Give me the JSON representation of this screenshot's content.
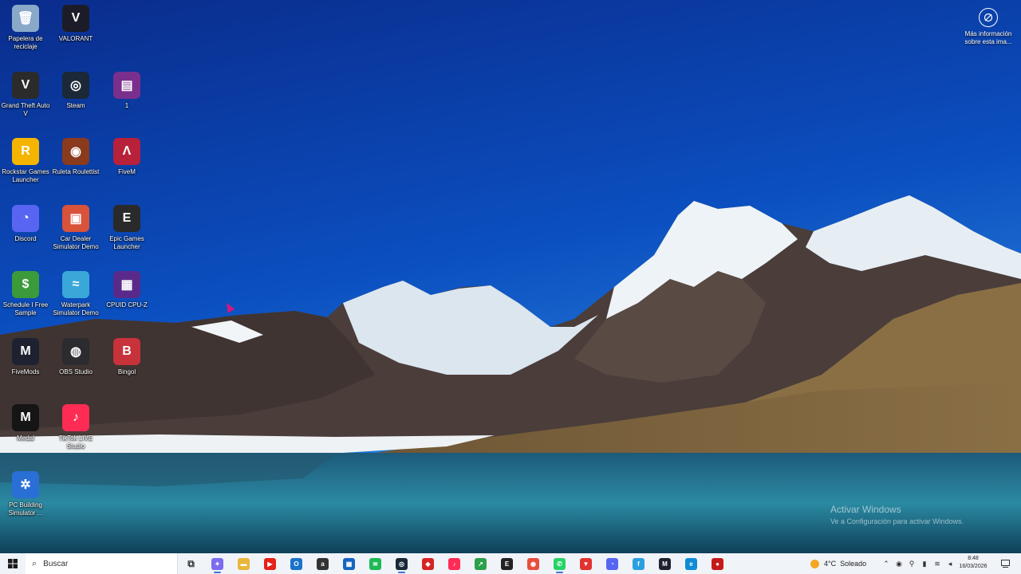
{
  "desktop": {
    "icons": [
      {
        "label": "Papelera de reciclaje",
        "icon": "recycle-bin-icon",
        "color": "#8aa9c9",
        "glyph": "🗑"
      },
      {
        "label": "VALORANT",
        "icon": "valorant-icon",
        "color": "#1c1c28",
        "glyph": "V"
      },
      {
        "label": "Grand Theft Auto V",
        "icon": "gta-v-icon",
        "color": "#2b2b2b",
        "glyph": "V"
      },
      {
        "label": "Steam",
        "icon": "steam-icon",
        "color": "#1b2838",
        "glyph": "◎"
      },
      {
        "label": "1",
        "icon": "winrar-icon",
        "color": "#7a2f8c",
        "glyph": "▤"
      },
      {
        "label": "Rockstar Games Launcher",
        "icon": "rockstar-icon",
        "color": "#f4b400",
        "glyph": "R"
      },
      {
        "label": "Ruleta Roulettist",
        "icon": "roulette-icon",
        "color": "#8a3a1d",
        "glyph": "◉"
      },
      {
        "label": "FiveM",
        "icon": "fivem-icon",
        "color": "#b8213a",
        "glyph": "Λ"
      },
      {
        "label": "Discord",
        "icon": "discord-icon",
        "color": "#5865f2",
        "glyph": "◔"
      },
      {
        "label": "Car Dealer Simulator Demo",
        "icon": "car-dealer-icon",
        "color": "#d9523a",
        "glyph": "▣"
      },
      {
        "label": "Epic Games Launcher",
        "icon": "epic-games-icon",
        "color": "#2a2a2a",
        "glyph": "E"
      },
      {
        "label": "Schedule I Free Sample",
        "icon": "schedule-i-icon",
        "color": "#3b9a3a",
        "glyph": "$"
      },
      {
        "label": "Waterpark Simulator Demo",
        "icon": "waterpark-icon",
        "color": "#3aa7d9",
        "glyph": "≈"
      },
      {
        "label": "CPUID CPU-Z",
        "icon": "cpu-z-icon",
        "color": "#5a2a8a",
        "glyph": "▦"
      },
      {
        "label": "FiveMods",
        "icon": "fivemods-icon",
        "color": "#1e2230",
        "glyph": "M"
      },
      {
        "label": "OBS Studio",
        "icon": "obs-icon",
        "color": "#2b2b30",
        "glyph": "◍"
      },
      {
        "label": "Bingol",
        "icon": "bingol-icon",
        "color": "#c8323a",
        "glyph": "B"
      },
      {
        "label": "Medal",
        "icon": "medal-icon",
        "color": "#151515",
        "glyph": "M"
      },
      {
        "label": "TikTok LIVE Studio",
        "icon": "tiktok-live-icon",
        "color": "#fe2c55",
        "glyph": "♪"
      },
      {
        "label": "PC Building Simulator ...",
        "icon": "pc-building-icon",
        "color": "#2a6fd6",
        "glyph": "✲"
      }
    ],
    "more_info": "Más información sobre esta ima...",
    "watermark": {
      "title": "Activar Windows",
      "subtitle": "Ve a Configuración para activar Windows."
    }
  },
  "taskbar": {
    "search_placeholder": "Buscar",
    "apps": [
      {
        "name": "task-view-icon",
        "color": "#445",
        "glyph": "⧉"
      },
      {
        "name": "copilot-icon",
        "color": "#7b6cf0",
        "glyph": "✦"
      },
      {
        "name": "file-explorer-icon",
        "color": "#e8b63a",
        "glyph": "▬"
      },
      {
        "name": "youtube-icon",
        "color": "#e62117",
        "glyph": "▶"
      },
      {
        "name": "outlook-icon",
        "color": "#1a73c9",
        "glyph": "O"
      },
      {
        "name": "amazon-icon",
        "color": "#333",
        "glyph": "a"
      },
      {
        "name": "microsoft-store-icon",
        "color": "#1565c0",
        "glyph": "▦"
      },
      {
        "name": "spotify-icon",
        "color": "#1db954",
        "glyph": "≋"
      },
      {
        "name": "steam-taskbar-icon",
        "color": "#1b2838",
        "glyph": "◎"
      },
      {
        "name": "red-app-icon",
        "color": "#d62424",
        "glyph": "◆"
      },
      {
        "name": "tiktok-taskbar-icon",
        "color": "#fe2c55",
        "glyph": "♪"
      },
      {
        "name": "green-app-icon",
        "color": "#2ca04a",
        "glyph": "↗"
      },
      {
        "name": "epic-taskbar-icon",
        "color": "#222",
        "glyph": "E"
      },
      {
        "name": "chrome-icon",
        "color": "#e84c3d",
        "glyph": "◉"
      },
      {
        "name": "whatsapp-icon",
        "color": "#25d366",
        "glyph": "✆"
      },
      {
        "name": "brave-icon",
        "color": "#e0332f",
        "glyph": "▼"
      },
      {
        "name": "discord-taskbar-icon",
        "color": "#5865f2",
        "glyph": "◔"
      },
      {
        "name": "notes-app-icon",
        "color": "#2aa0e0",
        "glyph": "f"
      },
      {
        "name": "fivemods-taskbar-icon",
        "color": "#1e2230",
        "glyph": "M"
      },
      {
        "name": "edge-icon",
        "color": "#0f8bd6",
        "glyph": "e"
      },
      {
        "name": "record-app-icon",
        "color": "#c41a1a",
        "glyph": "●"
      }
    ],
    "weather": {
      "temp": "4°C",
      "condition": "Soleado"
    },
    "clock": {
      "time": "8:48",
      "date": "16/03/2026"
    }
  },
  "colors": {
    "taskbar_bg": "#f0f3f8",
    "sky_top": "#0a2a8a",
    "accent": "#3a78d6"
  }
}
